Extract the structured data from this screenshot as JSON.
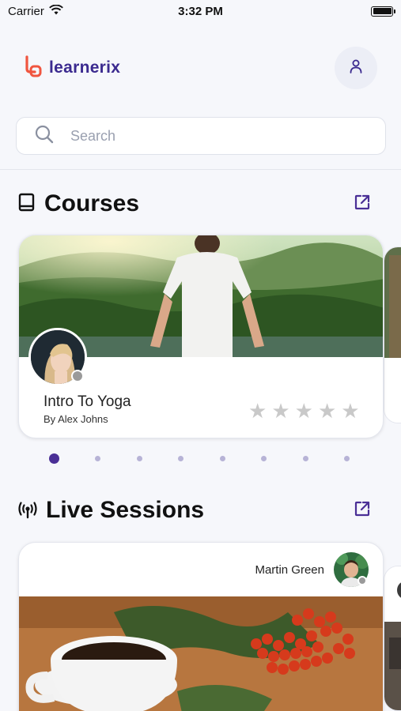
{
  "status_bar": {
    "carrier": "Carrier",
    "time": "3:32 PM"
  },
  "brand": {
    "name": "learnerix",
    "accent": "#f0553f",
    "color": "#3b2a8f"
  },
  "header": {
    "profile_icon": "user-icon"
  },
  "search": {
    "placeholder": "Search",
    "value": ""
  },
  "courses": {
    "title": "Courses",
    "icon": "book-icon",
    "action_icon": "external-link-icon",
    "cards": [
      {
        "title": "Intro To Yoga",
        "author": "By Alex Johns",
        "rating": 0,
        "max_rating": 5
      }
    ],
    "carousel": {
      "count": 8,
      "active_index": 0
    }
  },
  "live_sessions": {
    "title": "Live Sessions",
    "icon": "broadcast-icon",
    "action_icon": "external-link-icon",
    "cards": [
      {
        "host": "Martin Green"
      }
    ]
  },
  "colors": {
    "primary": "#4a2f96",
    "dot_inactive": "#b7b3d6",
    "star_empty": "#c9c9c9"
  }
}
